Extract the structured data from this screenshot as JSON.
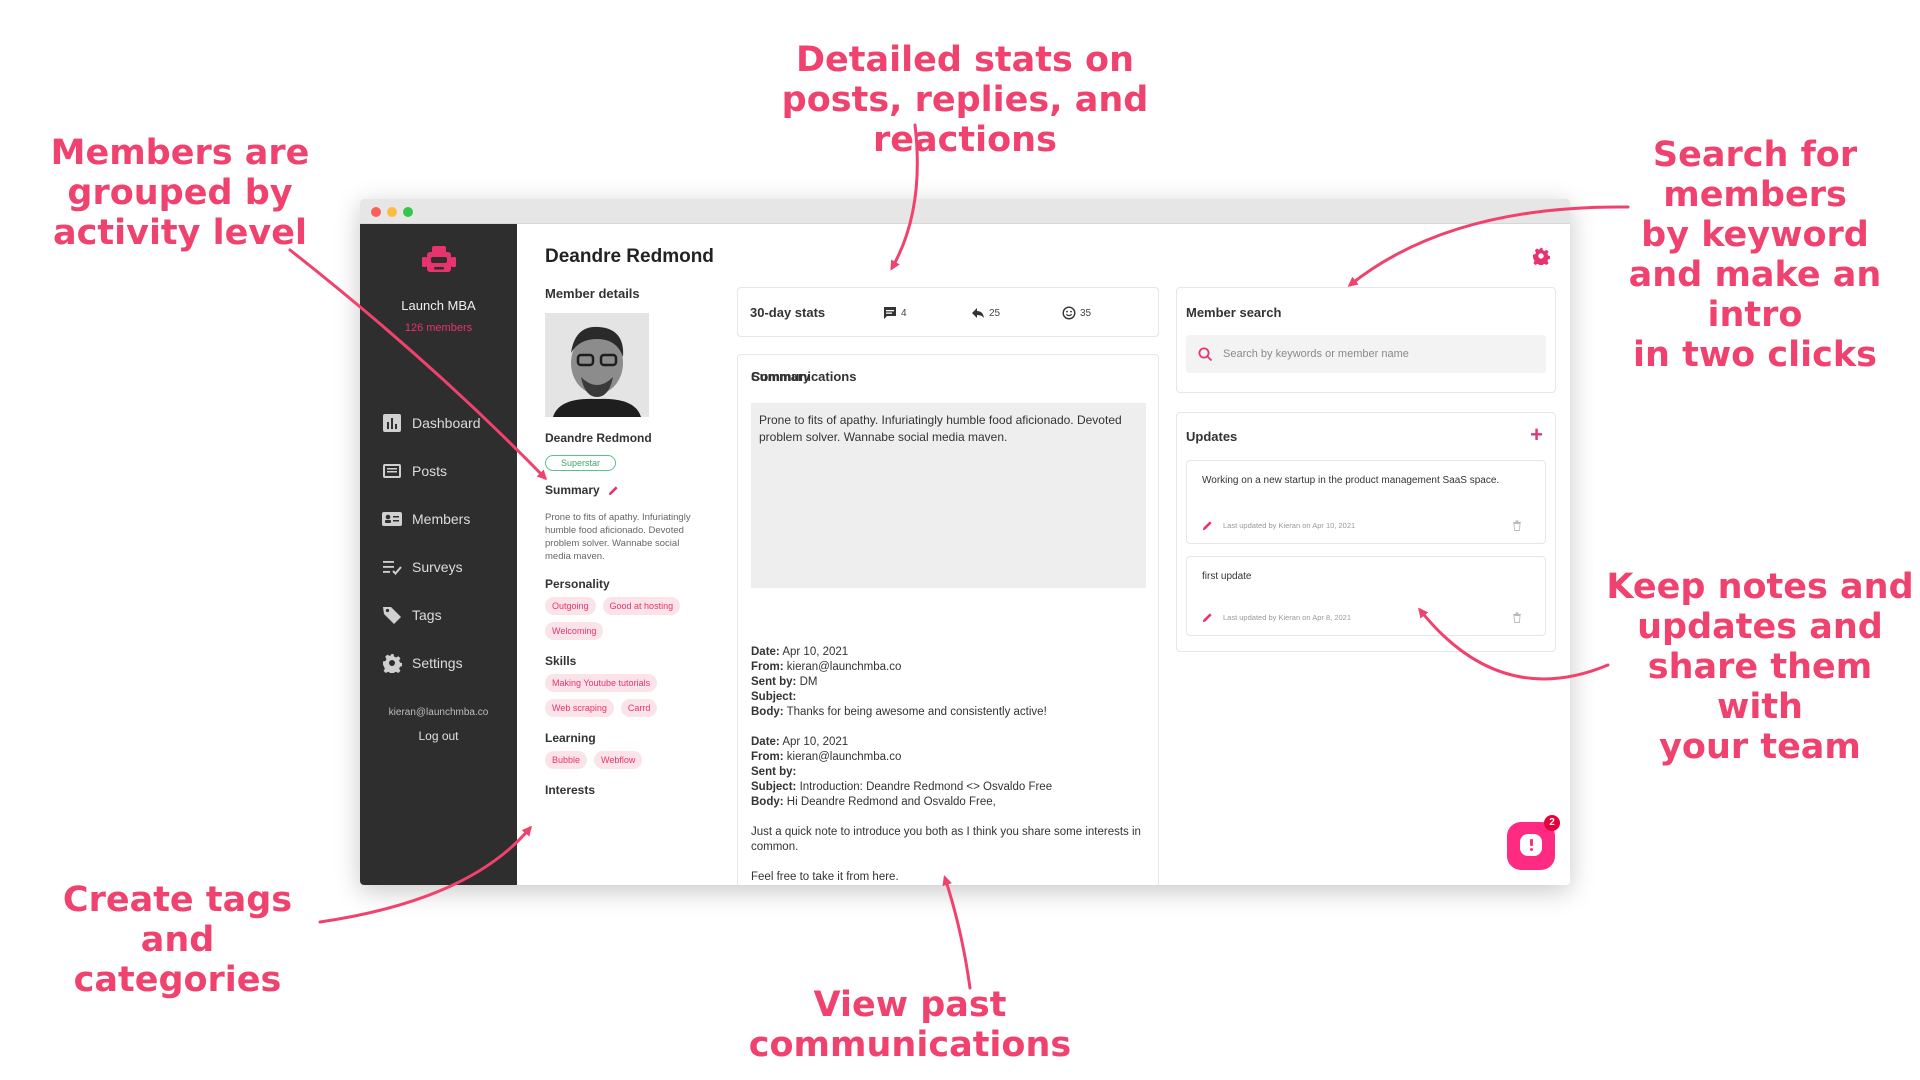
{
  "annotations": {
    "activity": "Members are\ngrouped by\nactivity level",
    "stats": "Detailed stats on\nposts, replies, and reactions",
    "search": "Search for\nmembers\nby keyword\nand make an intro\nin two clicks",
    "notes": "Keep notes and\nupdates and\nshare them with\nyour team",
    "tags": "Create tags\nand categories",
    "comms": "View past communications"
  },
  "sidebar": {
    "org_name": "Launch MBA",
    "org_members": "126 members",
    "items": [
      {
        "label": "Dashboard",
        "icon": "bar-chart-icon"
      },
      {
        "label": "Posts",
        "icon": "posts-icon"
      },
      {
        "label": "Members",
        "icon": "id-card-icon"
      },
      {
        "label": "Surveys",
        "icon": "survey-list-icon"
      },
      {
        "label": "Tags",
        "icon": "tag-icon"
      },
      {
        "label": "Settings",
        "icon": "gear-icon"
      }
    ],
    "email": "kieran@launchmba.co",
    "logout": "Log out"
  },
  "page": {
    "title": "Deandre Redmond"
  },
  "details": {
    "title": "Member details",
    "name": "Deandre Redmond",
    "level": "Superstar",
    "summary_title": "Summary",
    "summary": "Prone to fits of apathy. Infuriatingly humble food aficionado. Devoted problem solver. Wannabe social media maven.",
    "personality_title": "Personality",
    "personality": [
      "Outgoing",
      "Good at hosting",
      "Welcoming"
    ],
    "skills_title": "Skills",
    "skills": [
      "Making Youtube tutorials",
      "Web scraping",
      "Carrd"
    ],
    "learning_title": "Learning",
    "learning": [
      "Bubble",
      "Webflow"
    ],
    "interests_title": "Interests"
  },
  "stats": {
    "title": "30-day stats",
    "posts": "4",
    "replies": "25",
    "reactions": "35"
  },
  "summary": {
    "title": "Summary",
    "text": "Prone to fits of apathy. Infuriatingly humble food aficionado. Devoted problem solver. Wannabe social media maven."
  },
  "communications": {
    "title": "Communications",
    "labels": {
      "date": "Date:",
      "from": "From:",
      "sent_by": "Sent by:",
      "subject": "Subject:",
      "body": "Body:"
    },
    "items": [
      {
        "date": "Apr 10, 2021",
        "from": "kieran@launchmba.co",
        "sent_by": "DM",
        "subject": "",
        "body": "Thanks for being awesome and consistently active!"
      },
      {
        "date": "Apr 10, 2021",
        "from": "kieran@launchmba.co",
        "sent_by": "",
        "subject": "Introduction: Deandre Redmond <> Osvaldo Free",
        "body": "Hi Deandre Redmond and Osvaldo Free,",
        "body_p2": "Just a quick note to introduce you both as I think you share some interests in common.",
        "body_p3": "Feel free to take it from here."
      }
    ]
  },
  "search": {
    "title": "Member search",
    "placeholder": "Search by keywords or member name"
  },
  "updates": {
    "title": "Updates",
    "items": [
      {
        "text": "Working on a new startup in the product management SaaS space.",
        "meta": "Last updated by Kieran on Apr 10, 2021"
      },
      {
        "text": "first update",
        "meta": "Last updated by Kieran on Apr 8, 2021"
      }
    ]
  },
  "chat": {
    "badge": "2"
  },
  "colors": {
    "accent": "#e8336f",
    "annotation": "#f0426e",
    "sidebar": "#2e2e2e"
  }
}
